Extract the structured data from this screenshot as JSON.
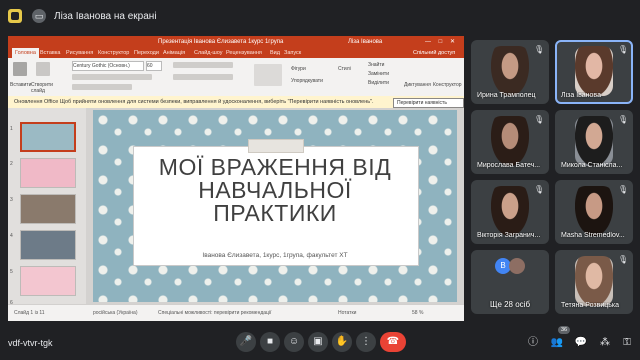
{
  "topbar": {
    "presenting_text": "Ліза Іванова на екрані"
  },
  "ppt": {
    "window_title": "Презентація Іванова Єлизавета 1курс 1група",
    "user": "Ліза Іванова",
    "window_controls": "— □ ✕",
    "tabs": [
      "Головна",
      "Вставка",
      "Рисування",
      "Конструктор",
      "Переходи",
      "Анімація",
      "Слайд-шоу",
      "Рецензування",
      "Вид",
      "Запуск"
    ],
    "share_label": "Спільний доступ",
    "ribbon": {
      "paste": "Вставити",
      "create_slide": "Створити слайд",
      "font_name": "Century Gothic (Основн.)",
      "font_size": "60",
      "shapes": "Фігури",
      "arrange": "Упорядкувати",
      "styles": "Стилі",
      "find": "Знайти",
      "replace": "Замінити",
      "select": "Виділити",
      "dictate": "Диктування",
      "design_ideas": "Конструктор"
    },
    "notice": {
      "text": "Оновлення Office  Щоб прийняти оновлення для системи безпеки, виправлення й удосконалення, виберіть \"Перевірити наявність оновлень\".",
      "button": "Перевірити наявність оновлень"
    },
    "slide": {
      "title": "МОЇ ВРАЖЕННЯ ВІД НАВЧАЛЬНОЇ ПРАКТИКИ",
      "subtitle": "Іванова Єлизавета, 1курс, 1група, факультет ХТ"
    },
    "thumbnails": [
      {
        "num": "1"
      },
      {
        "num": "2"
      },
      {
        "num": "3"
      },
      {
        "num": "4"
      },
      {
        "num": "5"
      },
      {
        "num": "6"
      }
    ],
    "status": {
      "slide": "Слайд 1 із 11",
      "lang": "російська (Україна)",
      "access": "Спеціальні можливості: перевірити рекомендації",
      "notes": "Нотатки",
      "zoom": "58 %"
    }
  },
  "participants": [
    {
      "name": "Ирина Трамполец",
      "muted": true,
      "skin": "#c49a84",
      "hair": "#3b2a22"
    },
    {
      "name": "Ліза Іванова",
      "muted": true,
      "active": true,
      "skin": "#e2b7a5",
      "hair": "#5a3a2c"
    },
    {
      "name": "Мирослава Батеч...",
      "muted": true,
      "skin": "#b58c78",
      "hair": "#2b1d17"
    },
    {
      "name": "Микола Станісла...",
      "muted": true,
      "skin": "#d2a893",
      "hair": "#1d1d1d"
    },
    {
      "name": "Вікторія Загранич...",
      "muted": true,
      "skin": "#caa08a",
      "hair": "#2a1c16"
    },
    {
      "name": "Masha Stremedlov...",
      "muted": true,
      "skin": "#c79a85",
      "hair": "#1c1410"
    }
  ],
  "more_tile": {
    "label": "Ще 28 осіб",
    "avatar_letter": "В"
  },
  "last_tile": {
    "name": "Тетяна Розвицька",
    "muted": true
  },
  "bottom": {
    "meeting_code": "vdf-vtvr-tgk",
    "participant_count": "36"
  }
}
